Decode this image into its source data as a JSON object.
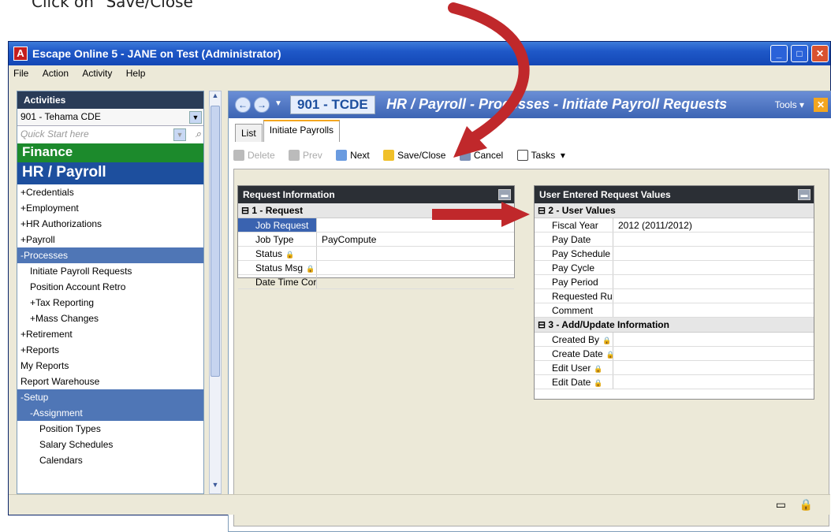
{
  "caption": "Click on \"Save/Close\"",
  "window": {
    "title": "Escape Online 5 - JANE on Test (Administrator)",
    "app_icon": "A"
  },
  "menu": [
    "File",
    "Action",
    "Activity",
    "Help"
  ],
  "left": {
    "header": "Activities",
    "org_select": "901 - Tehama CDE",
    "search_placeholder": "Quick Start here",
    "finance": "Finance",
    "hr": "HR / Payroll",
    "nav": [
      {
        "label": "+Credentials",
        "indent": 0,
        "sel": false
      },
      {
        "label": "+Employment",
        "indent": 0,
        "sel": false
      },
      {
        "label": "+HR Authorizations",
        "indent": 0,
        "sel": false
      },
      {
        "label": "+Payroll",
        "indent": 0,
        "sel": false
      },
      {
        "label": "-Processes",
        "indent": 0,
        "sel": true
      },
      {
        "label": "Initiate Payroll Requests",
        "indent": 1,
        "sel": false
      },
      {
        "label": "Position Account Retro",
        "indent": 1,
        "sel": false
      },
      {
        "label": "+Tax Reporting",
        "indent": 1,
        "sel": false
      },
      {
        "label": "+Mass Changes",
        "indent": 1,
        "sel": false
      },
      {
        "label": "+Retirement",
        "indent": 0,
        "sel": false
      },
      {
        "label": "+Reports",
        "indent": 0,
        "sel": false
      },
      {
        "label": "My Reports",
        "indent": 0,
        "sel": false
      },
      {
        "label": "Report Warehouse",
        "indent": 0,
        "sel": false
      },
      {
        "label": "-Setup",
        "indent": 0,
        "sel": true
      },
      {
        "label": "-Assignment",
        "indent": 1,
        "sel": true
      },
      {
        "label": "Position Types",
        "indent": 2,
        "sel": false
      },
      {
        "label": "Salary Schedules",
        "indent": 2,
        "sel": false
      },
      {
        "label": "Calendars",
        "indent": 2,
        "sel": false
      }
    ]
  },
  "right": {
    "org_code": "901 - TCDE",
    "page_title": "HR / Payroll - Processes - Initiate Payroll Requests",
    "tools": "Tools",
    "tabs": [
      "List",
      "Initiate Payrolls"
    ],
    "toolbar": {
      "delete": "Delete",
      "prev": "Prev",
      "next": "Next",
      "save_close": "Save/Close",
      "cancel": "Cancel",
      "tasks": "Tasks"
    },
    "request_panel": {
      "title": "Request Information",
      "group": "1 - Request",
      "rows": [
        {
          "label": "Job Request",
          "value": ""
        },
        {
          "label": "Job Type",
          "value": "PayCompute"
        },
        {
          "label": "Status",
          "value": ""
        },
        {
          "label": "Status Msg",
          "value": ""
        },
        {
          "label": "Date Time Cor",
          "value": ""
        }
      ]
    },
    "user_panel": {
      "title": "User Entered Request Values",
      "group2": "2 - User Values",
      "rows2": [
        {
          "label": "Fiscal Year",
          "value": "2012 (2011/2012)"
        },
        {
          "label": "Pay Date",
          "value": ""
        },
        {
          "label": "Pay Schedule",
          "value": ""
        },
        {
          "label": "Pay Cycle",
          "value": ""
        },
        {
          "label": "Pay Period",
          "value": ""
        },
        {
          "label": "Requested Ru",
          "value": ""
        },
        {
          "label": "Comment",
          "value": ""
        }
      ],
      "group3": "3 - Add/Update Information",
      "rows3": [
        {
          "label": "Created By",
          "value": ""
        },
        {
          "label": "Create Date",
          "value": ""
        },
        {
          "label": "Edit User",
          "value": ""
        },
        {
          "label": "Edit Date",
          "value": ""
        }
      ]
    }
  },
  "colors": {
    "title_blue": "#1f58c8",
    "finance_green": "#1c8a2c",
    "hr_blue": "#1d4f9e",
    "annotation_red": "#c0282b"
  }
}
